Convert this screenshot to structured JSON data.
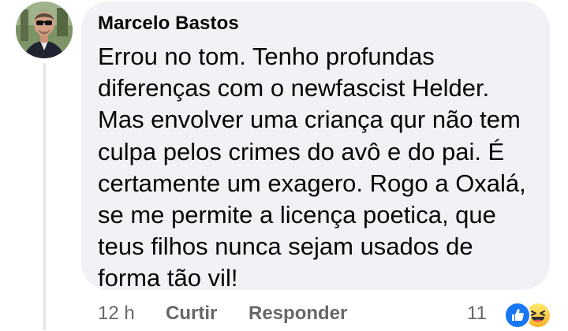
{
  "comment": {
    "author": "Marcelo Bastos",
    "text": "Errou no tom. Tenho profundas\ndiferenças com o newfascist Helder.\nMas envolver uma criança qur não tem\nculpa pelos crimes do avô e do pai. É\ncertamente um exagero. Rogo a Oxalá,\nse me permite a licença poetica, que\nteus filhos nunca sejam usados de\nforma tão vil!",
    "time": "12 h",
    "like_label": "Curtir",
    "reply_label": "Responder",
    "reaction_count": "11",
    "reactions": [
      "like-icon",
      "haha-icon"
    ]
  },
  "colors": {
    "bubble": "#f0f2f5",
    "text": "#050505",
    "secondary_text": "#65676b",
    "like_blue": "#1877f2",
    "haha_yellow": "#f7b125"
  }
}
